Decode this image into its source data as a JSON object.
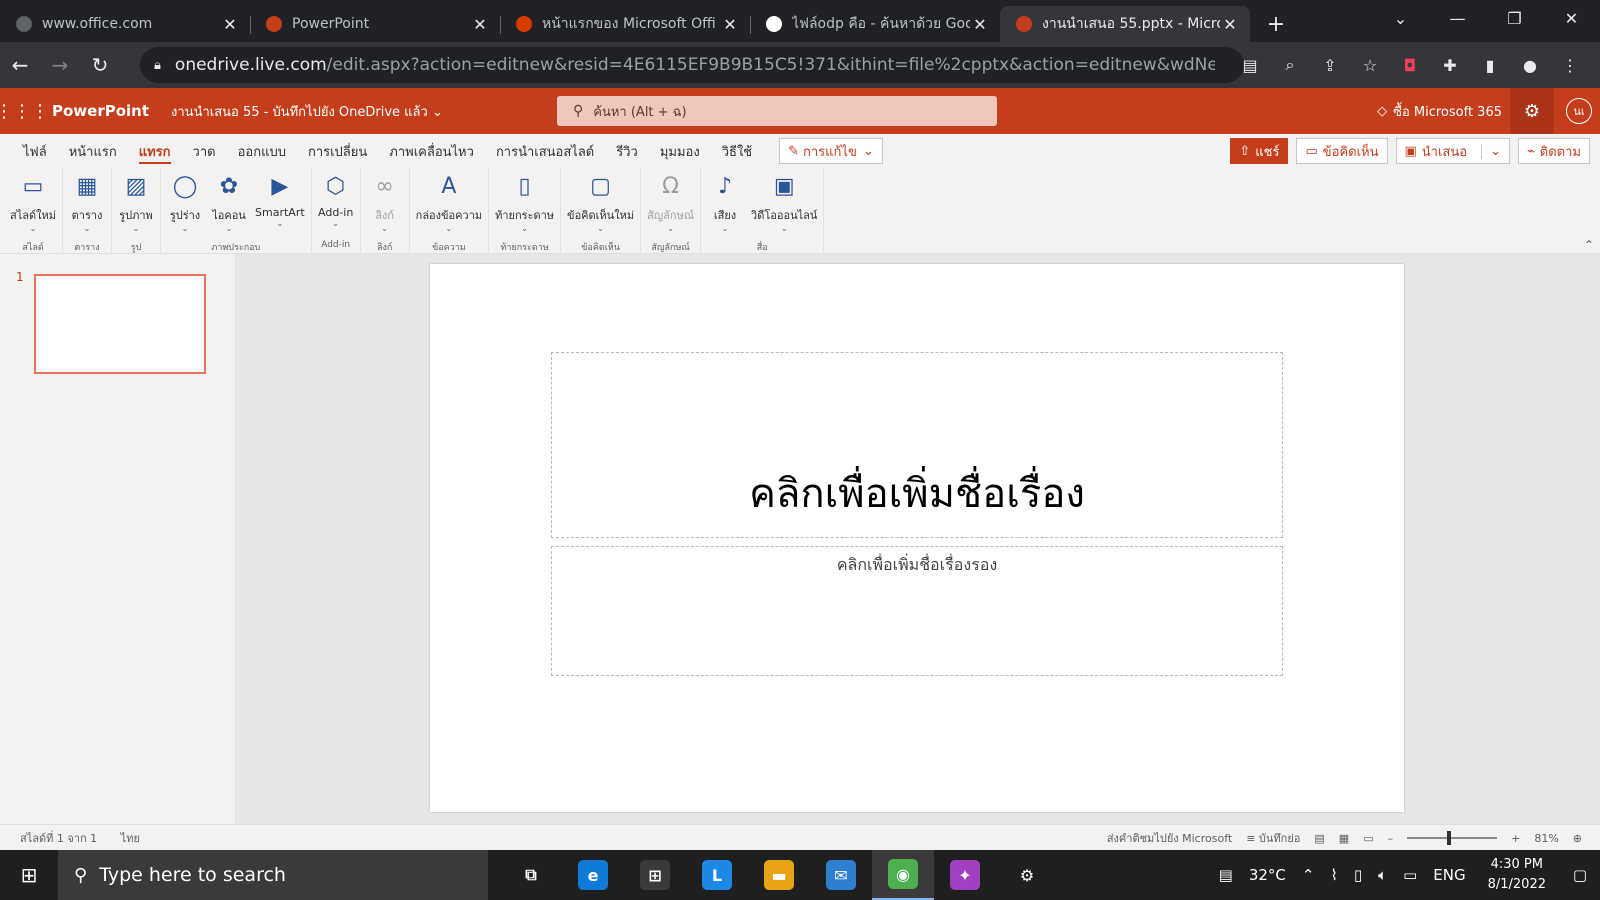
{
  "browser": {
    "tabs": [
      {
        "title": "www.office.com",
        "favicon_color": "#5f6368",
        "active": false
      },
      {
        "title": "PowerPoint",
        "favicon_color": "#c43e1c",
        "active": false
      },
      {
        "title": "หน้าแรกของ Microsoft Offi",
        "favicon_color": "#d83b01",
        "active": false
      },
      {
        "title": "ไฟล์odp คือ - ค้นหาด้วย Goo",
        "favicon_color": "#ffffff",
        "active": false
      },
      {
        "title": "งานนำเสนอ 55.pptx - Micro",
        "favicon_color": "#c43e1c",
        "active": true
      }
    ],
    "url_host": "onedrive.live.com",
    "url_path": "/edit.aspx?action=editnew&resid=4E6115EF9B9B15C5!371&ithint=file%2cpptx&action=editnew&wdNewAndOpen..."
  },
  "office": {
    "app_name": "PowerPoint",
    "doc_status": "งานนำเสนอ 55 - บันทึกไปยัง OneDrive แล้ว",
    "search_placeholder": "ค้นหา (Alt + ฉ)",
    "buy_label": "ซื้อ Microsoft 365",
    "avatar_initials": "นเ",
    "accent_color": "#c43e1c"
  },
  "ribbon_tabs": [
    "ไฟล์",
    "หน้าแรก",
    "แทรก",
    "วาด",
    "ออกแบบ",
    "การเปลี่ยน",
    "ภาพเคลื่อนไหว",
    "การนำเสนอสไลด์",
    "รีวิว",
    "มุมมอง",
    "วิธีใช้"
  ],
  "active_ribbon_tab": "แทรก",
  "edit_mode_label": "การแก้ไข",
  "actions": {
    "share": "แชร์",
    "comments": "ข้อคิดเห็น",
    "present": "นำเสนอ",
    "follow": "ติดตาม"
  },
  "ribbon_groups": [
    {
      "label": "สไลด์",
      "items": [
        {
          "label": "สไลด์ใหม่",
          "icon": "new-slide-icon",
          "glyph": "▭"
        }
      ]
    },
    {
      "label": "ตาราง",
      "items": [
        {
          "label": "ตาราง",
          "icon": "table-icon",
          "glyph": "▦"
        }
      ]
    },
    {
      "label": "รูป",
      "items": [
        {
          "label": "รูปภาพ",
          "icon": "picture-icon",
          "glyph": "▨"
        }
      ]
    },
    {
      "label": "ภาพประกอบ",
      "items": [
        {
          "label": "รูปร่าง",
          "icon": "shapes-icon",
          "glyph": "◯"
        },
        {
          "label": "ไอคอน",
          "icon": "icons-icon",
          "glyph": "✿"
        },
        {
          "label": "SmartArt",
          "icon": "smartart-icon",
          "glyph": "▶"
        }
      ]
    },
    {
      "label": "Add-in",
      "items": [
        {
          "label": "Add-in",
          "icon": "addin-icon",
          "glyph": "⬡"
        }
      ]
    },
    {
      "label": "ลิงก์",
      "items": [
        {
          "label": "ลิงก์",
          "icon": "link-icon",
          "glyph": "∞",
          "disabled": true
        }
      ]
    },
    {
      "label": "ข้อความ",
      "items": [
        {
          "label": "กล่องข้อความ",
          "icon": "textbox-icon",
          "glyph": "A"
        }
      ]
    },
    {
      "label": "ท้ายกระดาษ",
      "items": [
        {
          "label": "ท้ายกระดาษ",
          "icon": "footer-icon",
          "glyph": "▯"
        }
      ]
    },
    {
      "label": "ข้อคิดเห็น",
      "items": [
        {
          "label": "ข้อคิดเห็นใหม่",
          "icon": "new-comment-icon",
          "glyph": "▢"
        }
      ]
    },
    {
      "label": "สัญลักษณ์",
      "items": [
        {
          "label": "สัญลักษณ์",
          "icon": "symbol-icon",
          "glyph": "Ω",
          "disabled": true
        }
      ]
    },
    {
      "label": "สื่อ",
      "items": [
        {
          "label": "เสียง",
          "icon": "audio-icon",
          "glyph": "♪"
        },
        {
          "label": "วิดีโอออนไลน์",
          "icon": "online-video-icon",
          "glyph": "▣"
        }
      ]
    }
  ],
  "slide_panel": {
    "slide_number": "1"
  },
  "slide": {
    "title_placeholder": "คลิกเพื่อเพิ่มชื่อเรื่อง",
    "subtitle_placeholder": "คลิกเพื่อเพิ่มชื่อเรื่องรอง"
  },
  "statusbar": {
    "slide_info": "สไลด์ที่ 1 จาก 1",
    "language": "ไทย",
    "feedback": "ส่งคำติชมไปยัง Microsoft",
    "notes": "บันทึกย่อ",
    "zoom_out": "–",
    "zoom_in": "+",
    "zoom": "81%"
  },
  "taskbar": {
    "search_placeholder": "Type here to search",
    "temperature": "32°C",
    "language": "ENG",
    "time": "4:30 PM",
    "date": "8/1/2022",
    "apps": [
      {
        "name": "task-view",
        "glyph": "⧉",
        "color": "transparent",
        "active": false
      },
      {
        "name": "edge",
        "glyph": "e",
        "color": "#0f7bd6",
        "active": false
      },
      {
        "name": "store",
        "glyph": "⊞",
        "color": "#3a3a3a",
        "active": false
      },
      {
        "name": "l-app",
        "glyph": "L",
        "color": "#1e88e5",
        "active": false
      },
      {
        "name": "file-explorer",
        "glyph": "▬",
        "color": "#e8a317",
        "active": false
      },
      {
        "name": "mail",
        "glyph": "✉",
        "color": "#2f7fd1",
        "active": false
      },
      {
        "name": "chrome",
        "glyph": "◉",
        "color": "#4caf50",
        "active": true
      },
      {
        "name": "messenger",
        "glyph": "✦",
        "color": "#a040c0",
        "active": false
      },
      {
        "name": "settings",
        "glyph": "⚙",
        "color": "transparent",
        "active": false
      }
    ]
  }
}
